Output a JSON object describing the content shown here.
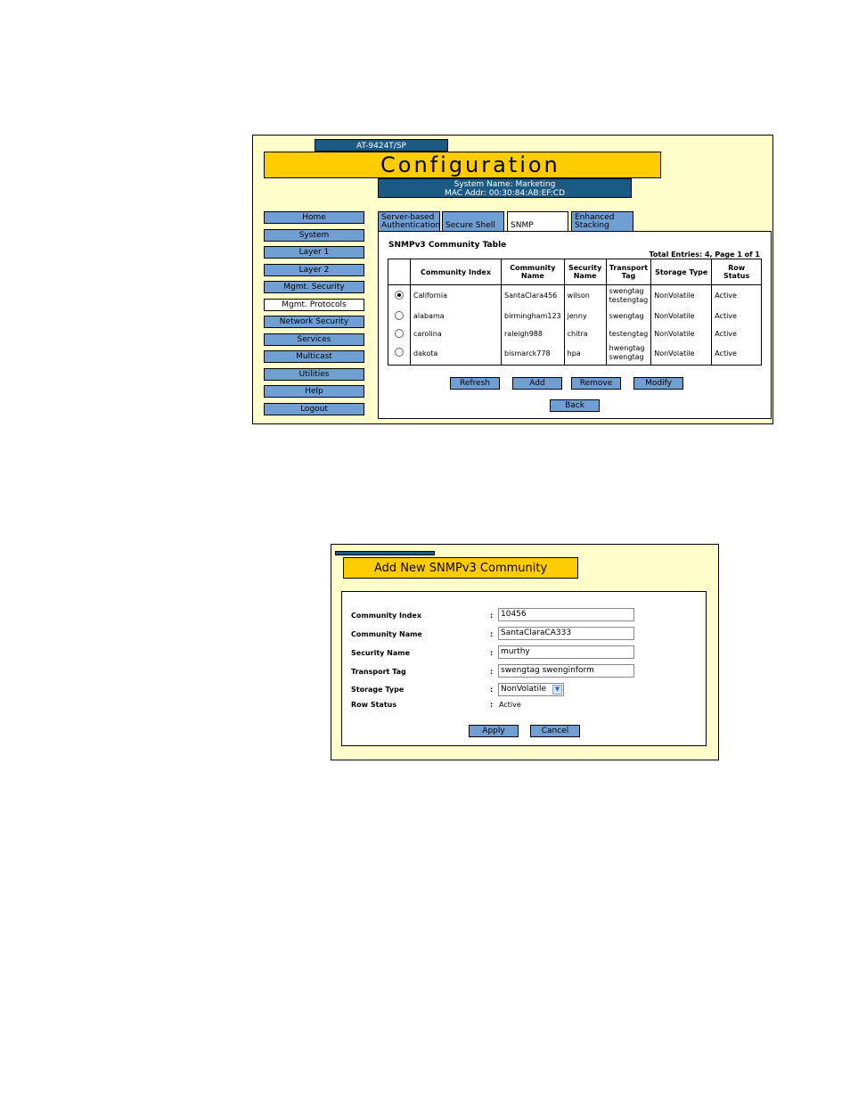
{
  "config_page": {
    "device_model": "AT-9424T/SP",
    "banner_title": "Configuration",
    "system_name_line": "System Name: Marketing",
    "mac_line": "MAC Addr: 00:30:84:AB:EF:CD",
    "nav": [
      "Home",
      "System",
      "Layer 1",
      "Layer 2",
      "Mgmt. Security",
      "Mgmt. Protocols",
      "Network Security",
      "Services",
      "Multicast",
      "Utilities",
      "Help",
      "Logout"
    ],
    "nav_active": "Mgmt. Protocols",
    "tabs": [
      {
        "line1": "Server-based",
        "line2": "Authentication"
      },
      {
        "line1": "Secure Shell",
        "line2": ""
      },
      {
        "line1": "SNMP",
        "line2": ""
      },
      {
        "line1": "Enhanced",
        "line2": "Stacking"
      }
    ],
    "active_tab": "SNMP",
    "table_title": "SNMPv3 Community Table",
    "total_entries": "Total Entries: 4, Page 1 of 1",
    "columns": [
      "",
      "Community Index",
      "Community Name",
      "Security Name",
      "Transport Tag",
      "Storage Type",
      "Row Status"
    ],
    "rows": [
      {
        "selected": true,
        "index": "California",
        "name": "SantaClara456",
        "security": "wilson",
        "tag": "swengtag testengtag",
        "storage": "NonVolatile",
        "status": "Active"
      },
      {
        "selected": false,
        "index": "alabama",
        "name": "birmingham123",
        "security": "jenny",
        "tag": "swengtag",
        "storage": "NonVolatile",
        "status": "Active"
      },
      {
        "selected": false,
        "index": "carolina",
        "name": "raleigh988",
        "security": "chitra",
        "tag": "testengtag",
        "storage": "NonVolatile",
        "status": "Active"
      },
      {
        "selected": false,
        "index": "dakota",
        "name": "bismarck778",
        "security": "hpa",
        "tag": "hwengtag swengtag",
        "storage": "NonVolatile",
        "status": "Active"
      }
    ],
    "buttons": {
      "refresh": "Refresh",
      "add": "Add",
      "remove": "Remove",
      "modify": "Modify",
      "back": "Back"
    }
  },
  "add_page": {
    "title": "Add New SNMPv3 Community",
    "fields": {
      "community_index": {
        "label": "Community Index",
        "value": "10456"
      },
      "community_name": {
        "label": "Community Name",
        "value": "SantaClaraCA333"
      },
      "security_name": {
        "label": "Security Name",
        "value": "murthy"
      },
      "transport_tag": {
        "label": "Transport Tag",
        "value": "swengtag swenginform"
      },
      "storage_type": {
        "label": "Storage Type",
        "value": "NonVolatile"
      },
      "row_status": {
        "label": "Row Status",
        "value": "Active"
      }
    },
    "colon": ":",
    "buttons": {
      "apply": "Apply",
      "cancel": "Cancel"
    }
  },
  "colors": {
    "page_bg": "#ffffcc",
    "banner": "#ffcc00",
    "header_blue": "#1c5a86",
    "button_blue": "#6f9fd3"
  }
}
